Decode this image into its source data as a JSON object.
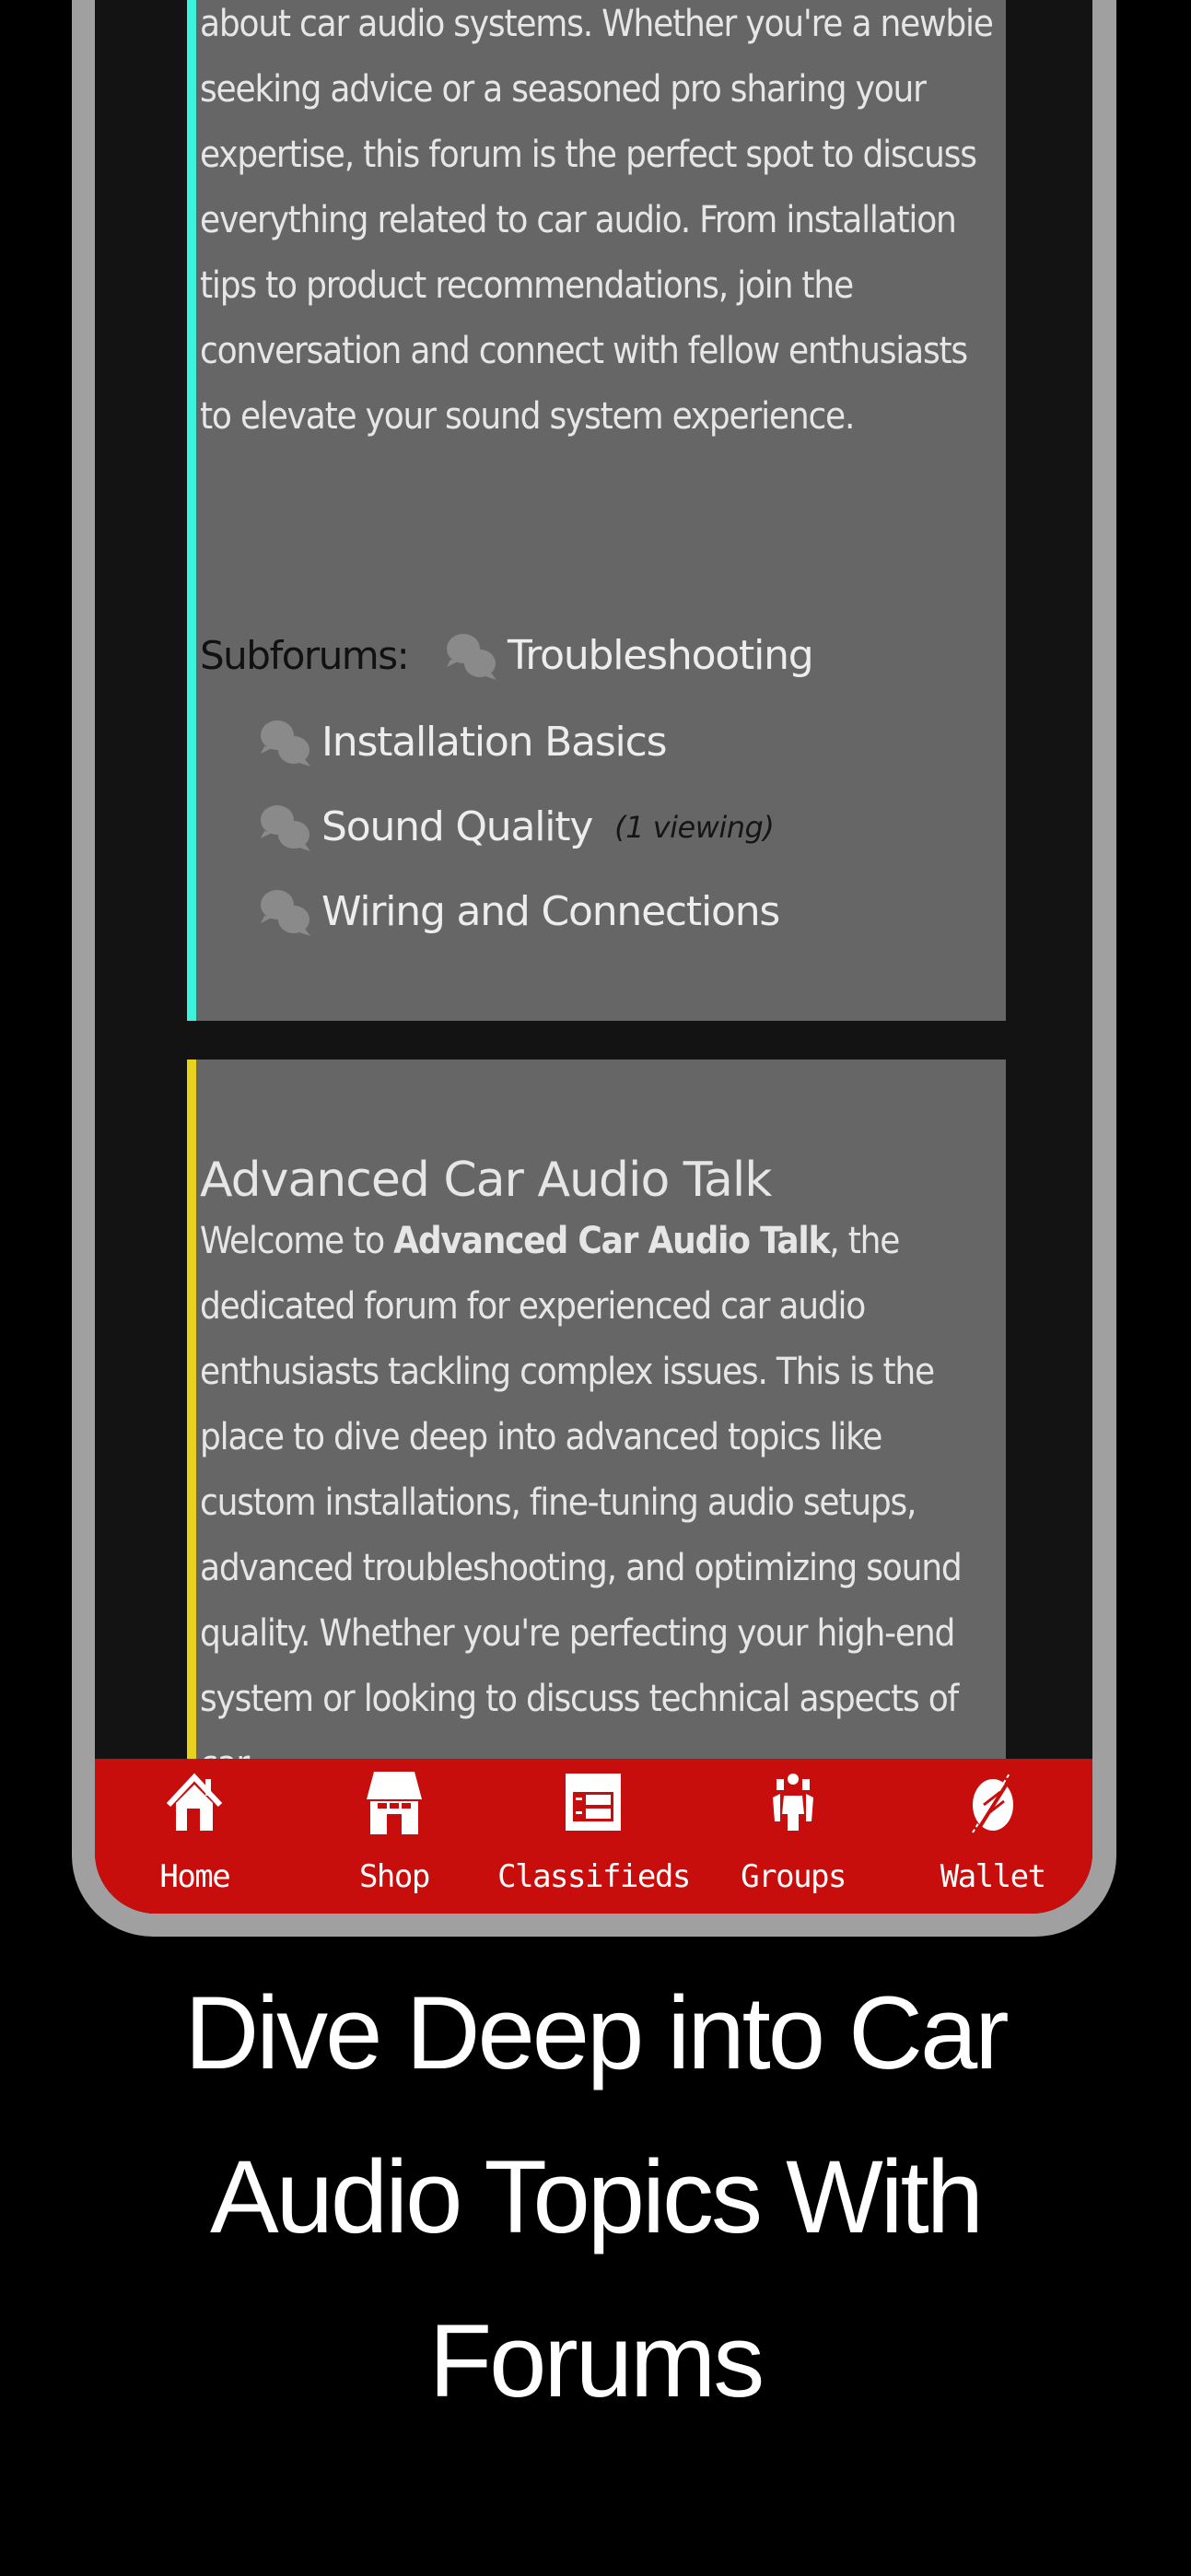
{
  "colors": {
    "background": "#000000",
    "phone_frame": "#a0a0a0",
    "screen_bg": "#131313",
    "card_bg": "#666666",
    "accent_forum_1": "#3df2dc",
    "accent_forum_2": "#e8d21e",
    "nav_bg": "#c80d0d",
    "text_light": "#e6e6e6"
  },
  "forums": [
    {
      "accent": "cyan",
      "description_visible": "about car audio systems. Whether you're a newbie seeking advice or a seasoned pro sharing your expertise, this forum is the perfect spot to discuss everything related to car audio. From installation tips to product recommendations, join the conversation and connect with fellow enthusiasts to elevate your sound system experience.",
      "subforums_label": "Subforums:",
      "subforums": [
        {
          "name": "Troubleshooting",
          "icon": "comments-icon"
        },
        {
          "name": "Installation Basics",
          "icon": "comments-icon"
        },
        {
          "name": "Sound Quality",
          "icon": "comments-icon",
          "viewing": "(1 viewing)"
        },
        {
          "name": "Wiring and Connections",
          "icon": "comments-icon"
        }
      ]
    },
    {
      "accent": "yellow",
      "title": "Advanced Car Audio Talk",
      "description_prefix": "Welcome to ",
      "description_bold": "Advanced Car Audio Talk",
      "description_rest": ", the dedicated forum for experienced car audio enthusiasts tackling complex issues. This is the place to dive deep into advanced topics like custom installations, fine-tuning audio setups, advanced troubleshooting, and optimizing sound quality. Whether you're perfecting your high-end system or looking to discuss technical aspects of car"
    }
  ],
  "nav": {
    "items": [
      {
        "label": "Home",
        "icon": "home-icon"
      },
      {
        "label": "Shop",
        "icon": "shop-icon"
      },
      {
        "label": "Classifieds",
        "icon": "classifieds-icon"
      },
      {
        "label": "Groups",
        "icon": "groups-icon"
      },
      {
        "label": "Wallet",
        "icon": "wallet-icon"
      }
    ]
  },
  "headline": {
    "lines": [
      "Dive Deep into Car",
      "Audio Topics With",
      "Forums"
    ]
  }
}
